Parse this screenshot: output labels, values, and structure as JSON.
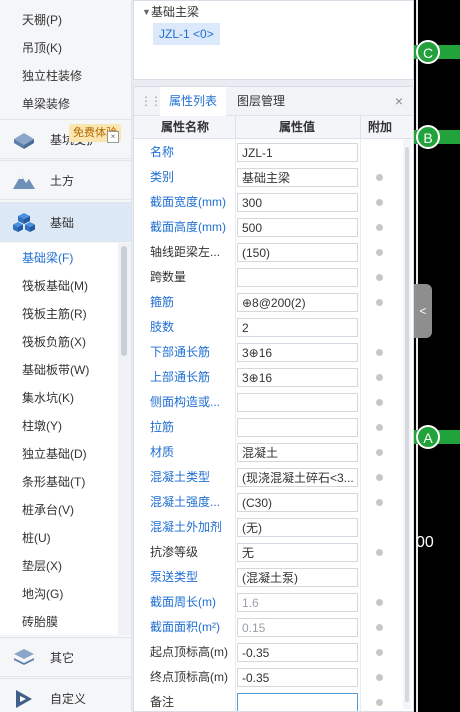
{
  "sidebar": {
    "top_items": [
      "天棚(P)",
      "吊顶(K)",
      "独立柱装修",
      "单梁装修"
    ],
    "categories": [
      {
        "label": "基坑",
        "suffix": "支护"
      },
      {
        "label": "土方"
      },
      {
        "label": "基础"
      }
    ],
    "free_badge": "免费体验",
    "sub_items": [
      "基础梁(F)",
      "筏板基础(M)",
      "筏板主筋(R)",
      "筏板负筋(X)",
      "基础板带(W)",
      "集水坑(K)",
      "柱墩(Y)",
      "独立基础(D)",
      "条形基础(T)",
      "桩承台(V)",
      "桩(U)",
      "垫层(X)",
      "地沟(G)",
      "砖胎膜"
    ],
    "bottom_categories": [
      {
        "label": "其它"
      },
      {
        "label": "自定义"
      }
    ]
  },
  "tree": {
    "root": "基础主梁",
    "child": "JZL-1 <0>"
  },
  "props": {
    "tabs": [
      "属性列表",
      "图层管理"
    ],
    "headers": {
      "name": "属性名称",
      "value": "属性值",
      "extra": "附加"
    },
    "rows": [
      {
        "name": "名称",
        "value": "JZL-1",
        "blue": true,
        "dot": false
      },
      {
        "name": "类别",
        "value": "基础主梁",
        "blue": true,
        "dot": true
      },
      {
        "name": "截面宽度(mm)",
        "value": "300",
        "blue": true,
        "dot": true
      },
      {
        "name": "截面高度(mm)",
        "value": "500",
        "blue": true,
        "dot": true
      },
      {
        "name": "轴线距梁左...",
        "value": "(150)",
        "blue": false,
        "dot": true
      },
      {
        "name": "跨数量",
        "value": "",
        "blue": false,
        "dot": true
      },
      {
        "name": "箍筋",
        "value": "⊕8@200(2)",
        "blue": true,
        "dot": true
      },
      {
        "name": "肢数",
        "value": "2",
        "blue": true,
        "dot": false
      },
      {
        "name": "下部通长筋",
        "value": "3⊕16",
        "blue": true,
        "dot": true
      },
      {
        "name": "上部通长筋",
        "value": "3⊕16",
        "blue": true,
        "dot": true
      },
      {
        "name": "侧面构造或...",
        "value": "",
        "blue": true,
        "dot": true
      },
      {
        "name": "拉筋",
        "value": "",
        "blue": true,
        "dot": true
      },
      {
        "name": "材质",
        "value": "混凝土",
        "blue": true,
        "dot": true
      },
      {
        "name": "混凝土类型",
        "value": "(现浇混凝土碎石<3...",
        "blue": true,
        "dot": true
      },
      {
        "name": "混凝土强度...",
        "value": "(C30)",
        "blue": true,
        "dot": true
      },
      {
        "name": "混凝土外加剂",
        "value": "(无)",
        "blue": true,
        "dot": false
      },
      {
        "name": "抗渗等级",
        "value": "无",
        "blue": false,
        "dot": true
      },
      {
        "name": "泵送类型",
        "value": "(混凝土泵)",
        "blue": true,
        "dot": false
      },
      {
        "name": "截面周长(m)",
        "value": "1.6",
        "blue": true,
        "dot": true,
        "gray": true
      },
      {
        "name": "截面面积(m²)",
        "value": "0.15",
        "blue": true,
        "dot": true,
        "gray": true
      },
      {
        "name": "起点顶标高(m)",
        "value": "-0.35",
        "blue": false,
        "dot": true
      },
      {
        "name": "终点顶标高(m)",
        "value": "-0.35",
        "blue": false,
        "dot": true
      },
      {
        "name": "备注",
        "value": "",
        "blue": false,
        "dot": true,
        "focus": true
      }
    ]
  },
  "canvas": {
    "axes": [
      "C",
      "B",
      "A"
    ],
    "partial_number": "00",
    "side_tab": "<"
  }
}
